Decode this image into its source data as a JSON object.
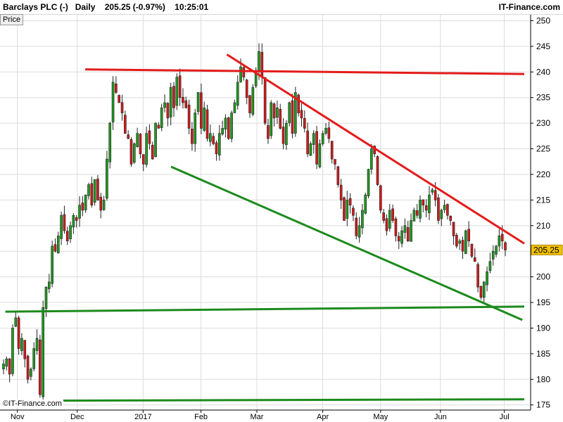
{
  "header": {
    "instrument": "Barclays PLC (-)",
    "interval": "Daily",
    "price": "205.25",
    "change": "(-0.97%)",
    "time": "10:25:01",
    "site": "IT-Finance.com"
  },
  "panel_label": "Price",
  "copyright": "©IT-Finance.com",
  "colors": {
    "up": "#1f9a1f",
    "down": "#d21a1a",
    "resistance": "#e41b1b",
    "support": "#1c8a1c",
    "grid": "#dcdcdc",
    "last_price_tag": "#f2c100"
  },
  "chart_data": {
    "type": "candlestick",
    "y_ticks": [
      175,
      180,
      185,
      190,
      195,
      200,
      205,
      210,
      215,
      220,
      225,
      230,
      235,
      240,
      245,
      250
    ],
    "ylim": [
      174,
      251.3
    ],
    "x_ticks": [
      {
        "label": "Nov",
        "date": "2016-11-01"
      },
      {
        "label": "Dec",
        "date": "2016-12-01"
      },
      {
        "label": "2017",
        "date": "2017-01-03"
      },
      {
        "label": "Feb",
        "date": "2017-02-01"
      },
      {
        "label": "Mar",
        "date": "2017-03-01"
      },
      {
        "label": "Apr",
        "date": "2017-04-03"
      },
      {
        "label": "May",
        "date": "2017-05-02"
      },
      {
        "label": "Jun",
        "date": "2017-06-01"
      },
      {
        "label": "Jul",
        "date": "2017-07-03"
      }
    ],
    "last_price": 205.25,
    "closes": [
      183,
      184,
      181,
      190,
      192,
      186,
      188,
      184,
      180,
      182,
      186,
      188,
      177,
      194,
      198,
      199,
      206,
      205,
      208,
      212,
      209,
      207,
      210,
      212,
      211,
      214,
      213,
      216,
      218,
      214,
      219,
      215,
      213,
      215,
      223,
      230,
      238,
      236,
      234,
      232,
      228,
      227,
      222,
      226,
      228,
      224,
      222,
      228,
      226,
      223,
      230,
      229,
      233,
      234,
      231,
      237,
      233,
      239,
      235,
      234,
      233,
      229,
      226,
      232,
      236,
      229,
      233,
      227,
      228,
      226,
      224,
      228,
      229,
      231,
      227,
      232,
      234,
      238,
      241,
      239,
      235,
      232,
      237,
      240,
      244,
      239,
      230,
      227,
      234,
      231,
      233,
      229,
      226,
      230,
      234,
      228,
      236,
      232,
      231,
      229,
      224,
      226,
      228,
      222,
      226,
      228,
      229,
      227,
      223,
      222,
      218,
      215,
      211,
      215,
      214,
      212,
      208,
      210,
      213,
      216,
      221,
      225,
      224,
      218,
      213,
      211,
      209,
      213,
      211,
      208,
      207,
      209,
      210,
      207,
      211,
      213,
      212,
      215,
      214,
      213,
      216,
      217,
      215,
      211,
      213,
      214,
      212,
      211,
      208,
      206,
      207,
      205,
      209,
      207,
      204,
      203,
      198,
      196,
      199,
      201,
      203,
      205,
      206,
      208,
      207,
      205.25
    ],
    "resistance_lines": [
      {
        "from": {
          "date": "2016-12-05",
          "price": 240.5
        },
        "to": {
          "date": "2017-07-13",
          "price": 239.6
        }
      },
      {
        "from": {
          "date": "2017-02-14",
          "price": 243.4
        },
        "to": {
          "date": "2017-07-13",
          "price": 206.5
        }
      }
    ],
    "support_lines": [
      {
        "from": {
          "date": "2017-01-17",
          "price": 221.5
        },
        "to": {
          "date": "2017-07-12",
          "price": 191.6
        }
      },
      {
        "from": {
          "date": "2016-10-26",
          "price": 193.2
        },
        "to": {
          "date": "2017-07-13",
          "price": 194.2
        }
      },
      {
        "from": {
          "date": "2016-10-26",
          "price": 175.8
        },
        "to": {
          "date": "2017-07-13",
          "price": 176.1
        }
      }
    ]
  }
}
